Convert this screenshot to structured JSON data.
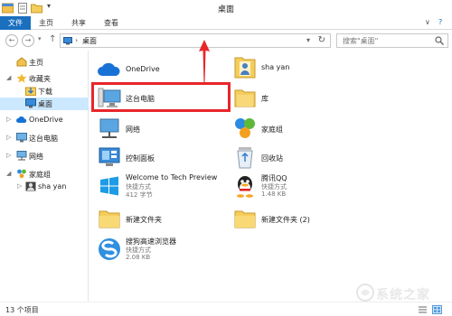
{
  "window": {
    "title": "桌面"
  },
  "ribbon": {
    "tabs": [
      "文件",
      "主页",
      "共享",
      "查看"
    ],
    "chevron": "∨",
    "help": "?"
  },
  "address": {
    "location": "桌面",
    "separator": "›",
    "search_placeholder": "搜索\"桌面\""
  },
  "nav": {
    "back": "←",
    "forward": "→",
    "recent": "▾",
    "up": "↑",
    "items": [
      {
        "label": "主页",
        "icon": "home-icon"
      },
      {
        "label": "收藏夹",
        "icon": "star-icon"
      },
      {
        "label": "下载",
        "icon": "download-icon"
      },
      {
        "label": "桌面",
        "icon": "desktop-icon"
      },
      {
        "label": "OneDrive",
        "icon": "cloud-icon"
      },
      {
        "label": "这台电脑",
        "icon": "computer-icon"
      },
      {
        "label": "网络",
        "icon": "network-icon"
      },
      {
        "label": "家庭组",
        "icon": "homegroup-icon"
      },
      {
        "label": "sha yan",
        "icon": "user-icon"
      }
    ]
  },
  "files": [
    {
      "name": "OneDrive",
      "icon": "cloud-icon"
    },
    {
      "name": "sha yan",
      "icon": "user-folder-icon"
    },
    {
      "name": "这台电脑",
      "icon": "computer-icon"
    },
    {
      "name": "库",
      "icon": "library-icon"
    },
    {
      "name": "网络",
      "icon": "network-icon"
    },
    {
      "name": "家庭组",
      "icon": "homegroup-icon"
    },
    {
      "name": "控制面板",
      "icon": "control-panel-icon"
    },
    {
      "name": "回收站",
      "icon": "recycle-bin-icon"
    },
    {
      "name": "Welcome to Tech Preview",
      "type": "快捷方式",
      "size": "412 字节",
      "icon": "windows-logo-icon"
    },
    {
      "name": "腾讯QQ",
      "type": "快捷方式",
      "size": "1.48 KB",
      "icon": "qq-icon"
    },
    {
      "name": "新建文件夹",
      "icon": "folder-icon"
    },
    {
      "name": "新建文件夹 (2)",
      "icon": "folder-icon"
    },
    {
      "name": "搜狗高速浏览器",
      "type": "快捷方式",
      "size": "2.08 KB",
      "icon": "sogou-browser-icon"
    }
  ],
  "status": {
    "count": "13 个项目"
  },
  "watermark": {
    "text": "系统之家"
  },
  "colors": {
    "accent": "#1a6fbf",
    "highlight": "#e8262a",
    "selected": "#cce8ff"
  }
}
